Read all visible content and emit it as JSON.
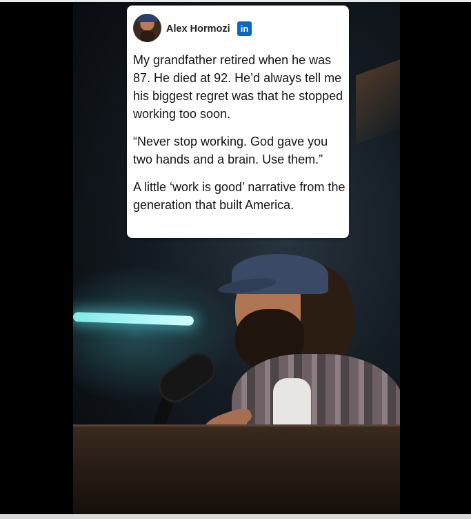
{
  "post": {
    "author_name": "Alex Hormozi",
    "platform_badge": "in",
    "paragraphs": [
      "My grandfather retired when he was 87. He died at 92. He’d always tell me his biggest regret was that he stopped working too soon.",
      "“Never stop working. God gave you two hands and a brain. Use them.”",
      "A little ‘work is good’ narrative from the generation that built America."
    ]
  },
  "icons": {
    "author_avatar": "avatar-icon",
    "platform": "linkedin-icon"
  },
  "colors": {
    "linkedin_blue": "#0a66c2",
    "card_background": "#ffffff",
    "page_background": "#000000"
  }
}
